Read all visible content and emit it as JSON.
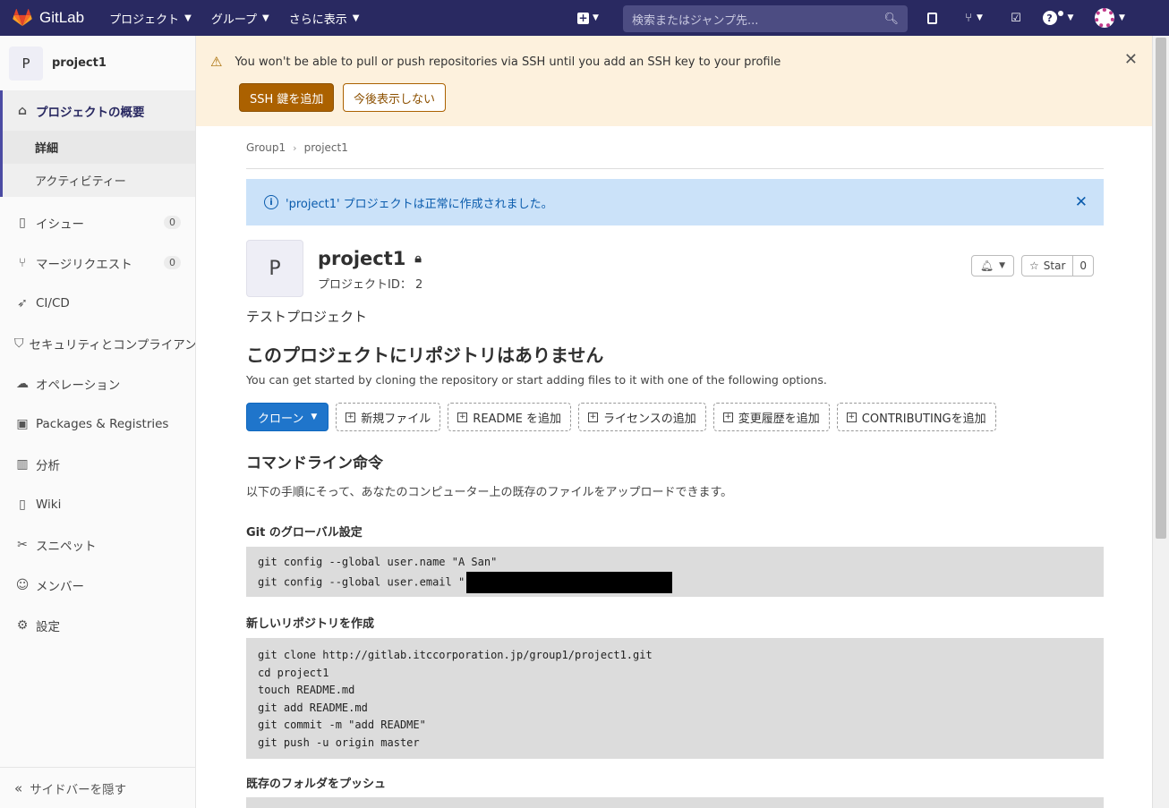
{
  "topbar": {
    "brand": "GitLab",
    "menu": [
      {
        "label": "プロジェクト"
      },
      {
        "label": "グループ"
      },
      {
        "label": "さらに表示"
      }
    ],
    "search_placeholder": "検索またはジャンプ先..."
  },
  "sidebar": {
    "avatar_letter": "P",
    "project_name": "project1",
    "overview_label": "プロジェクトの概要",
    "overview_sub": [
      {
        "label": "詳細"
      },
      {
        "label": "アクティビティー"
      }
    ],
    "items": [
      {
        "label": "イシュー",
        "count": "0",
        "icon": "issues-icon"
      },
      {
        "label": "マージリクエスト",
        "count": "0",
        "icon": "merge-request-icon"
      },
      {
        "label": "CI/CD",
        "icon": "rocket-icon"
      },
      {
        "label": "セキュリティとコンプライアンス",
        "icon": "shield-icon"
      },
      {
        "label": "オペレーション",
        "icon": "cloud-gear-icon"
      },
      {
        "label": "Packages & Registries",
        "icon": "package-icon"
      },
      {
        "label": "分析",
        "icon": "chart-icon"
      },
      {
        "label": "Wiki",
        "icon": "book-icon"
      },
      {
        "label": "スニペット",
        "icon": "scissors-icon"
      },
      {
        "label": "メンバー",
        "icon": "users-icon"
      },
      {
        "label": "設定",
        "icon": "gear-icon"
      }
    ],
    "collapse_label": "サイドバーを隠す"
  },
  "banner": {
    "message": "You won't be able to pull or push repositories via SSH until you add an SSH key to your profile",
    "add_ssh_label": "SSH 鍵を追加",
    "dont_show_label": "今後表示しない"
  },
  "breadcrumb": [
    "Group1",
    "project1"
  ],
  "alert": {
    "message": "'project1' プロジェクトは正常に作成されました。"
  },
  "project": {
    "avatar_letter": "P",
    "name": "project1",
    "id_label": "プロジェクトID： 2",
    "star_label": "Star",
    "star_count": "0",
    "description": "テストプロジェクト"
  },
  "empty": {
    "title": "このプロジェクトにリポジトリはありません",
    "subtitle": "You can get started by cloning the repository or start adding files to it with one of the following options.",
    "clone_label": "クローン",
    "actions": [
      {
        "label": "新規ファイル"
      },
      {
        "label": "README を追加"
      },
      {
        "label": "ライセンスの追加"
      },
      {
        "label": "変更履歴を追加"
      },
      {
        "label": "CONTRIBUTINGを追加"
      }
    ]
  },
  "cli": {
    "title": "コマンドライン命令",
    "description": "以下の手順にそって、あなたのコンピューター上の既存のファイルをアップロードできます。",
    "global_title": "Git のグローバル設定",
    "global_lines": [
      "git config --global user.name \"A San\"",
      "git config --global user.email \""
    ],
    "new_repo_title": "新しいリポジトリを作成",
    "new_repo_lines": [
      "git clone http://gitlab.itccorporation.jp/group1/project1.git",
      "cd project1",
      "touch README.md",
      "git add README.md",
      "git commit -m \"add README\"",
      "git push -u origin master"
    ],
    "push_folder_title": "既存のフォルダをプッシュ"
  }
}
